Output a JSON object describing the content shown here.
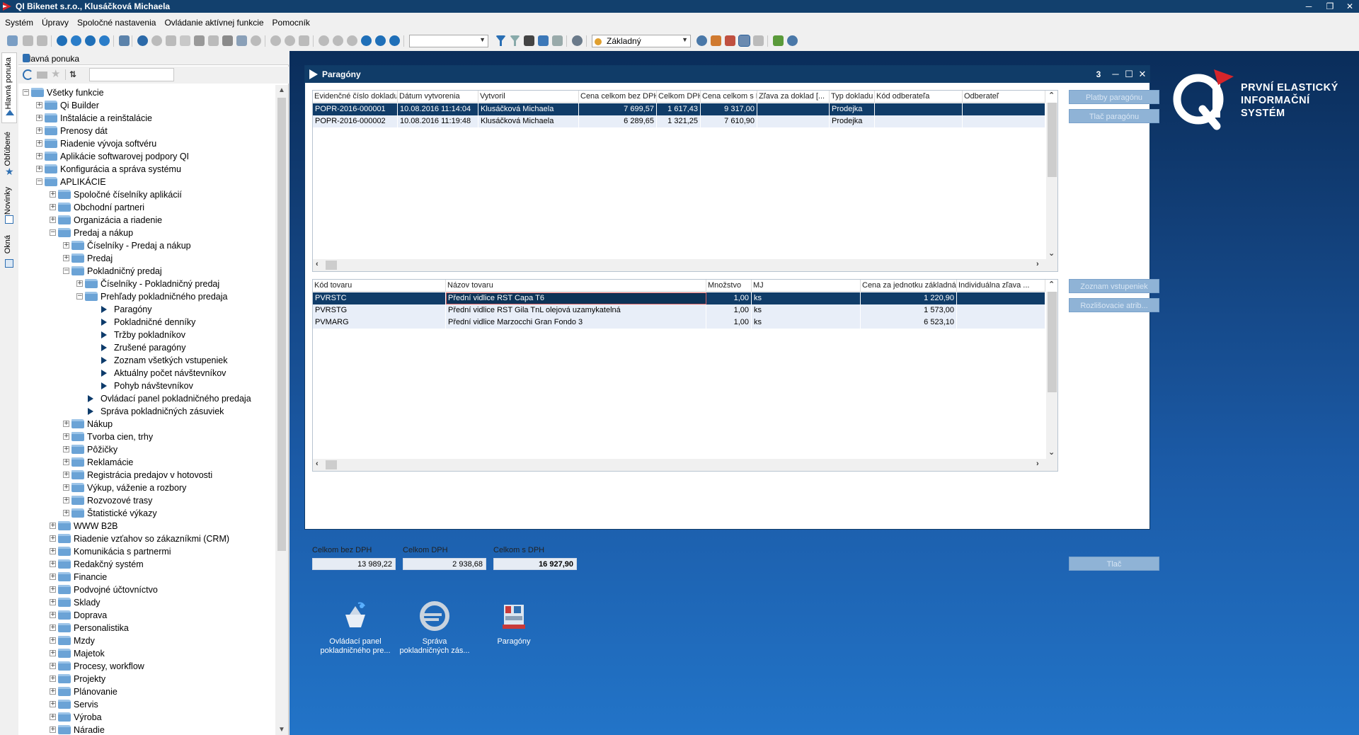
{
  "app": {
    "title": "QI  Bikenet s.r.o., Klusáčková Michaela",
    "controls": {
      "minimize": "─",
      "restore": "❐",
      "close": "✕"
    }
  },
  "menu": [
    "Systém",
    "Úpravy",
    "Spoločné nastavenia",
    "Ovládanie aktívnej funkcie",
    "Pomocník"
  ],
  "toolbar": {
    "view_combo": "Základný",
    "accent": "#2e6fb2"
  },
  "vtabs": [
    "Hlavná ponuka",
    "Obľúbené",
    "Novinky",
    "Okná"
  ],
  "left_panel": {
    "title": "Hlavná ponuka",
    "search_placeholder": ""
  },
  "tree": [
    {
      "label": "Všetky funkcie",
      "level": 0,
      "type": "folder",
      "exp": "-"
    },
    {
      "label": "Qi Builder",
      "level": 1,
      "type": "folder",
      "exp": "+"
    },
    {
      "label": "Inštalácie a reinštalácie",
      "level": 1,
      "type": "folder",
      "exp": "+"
    },
    {
      "label": "Prenosy dát",
      "level": 1,
      "type": "folder",
      "exp": "+"
    },
    {
      "label": "Riadenie vývoja softvéru",
      "level": 1,
      "type": "folder",
      "exp": "+"
    },
    {
      "label": "Aplikácie softwarovej podpory QI",
      "level": 1,
      "type": "folder",
      "exp": "+"
    },
    {
      "label": "Konfigurácia a správa systému",
      "level": 1,
      "type": "folder",
      "exp": "+"
    },
    {
      "label": "APLIKÁCIE",
      "level": 1,
      "type": "folder",
      "exp": "-"
    },
    {
      "label": "Spoločné číselníky aplikácií",
      "level": 2,
      "type": "folder",
      "exp": "+"
    },
    {
      "label": "Obchodní partneri",
      "level": 2,
      "type": "folder",
      "exp": "+"
    },
    {
      "label": "Organizácia a riadenie",
      "level": 2,
      "type": "folder",
      "exp": "+"
    },
    {
      "label": "Predaj a nákup",
      "level": 2,
      "type": "folder",
      "exp": "-"
    },
    {
      "label": "Číselníky - Predaj a nákup",
      "level": 3,
      "type": "folder",
      "exp": "+"
    },
    {
      "label": "Predaj",
      "level": 3,
      "type": "folder",
      "exp": "+"
    },
    {
      "label": "Pokladničný predaj",
      "level": 3,
      "type": "folder",
      "exp": "-"
    },
    {
      "label": "Číselníky - Pokladničný predaj",
      "level": 4,
      "type": "folder",
      "exp": "+"
    },
    {
      "label": "Prehľady pokladničného predaja",
      "level": 4,
      "type": "folder",
      "exp": "-"
    },
    {
      "label": "Paragóny",
      "level": 5,
      "type": "leaf"
    },
    {
      "label": "Pokladničné denníky",
      "level": 5,
      "type": "leaf"
    },
    {
      "label": "Tržby pokladníkov",
      "level": 5,
      "type": "leaf"
    },
    {
      "label": "Zrušené paragóny",
      "level": 5,
      "type": "leaf"
    },
    {
      "label": "Zoznam všetkých vstupeniek",
      "level": 5,
      "type": "leaf"
    },
    {
      "label": "Aktuálny počet návštevníkov",
      "level": 5,
      "type": "leaf"
    },
    {
      "label": "Pohyb návštevníkov",
      "level": 5,
      "type": "leaf"
    },
    {
      "label": "Ovládací panel pokladničného predaja",
      "level": 4,
      "type": "leaf"
    },
    {
      "label": "Správa pokladničných zásuviek",
      "level": 4,
      "type": "leaf"
    },
    {
      "label": "Nákup",
      "level": 3,
      "type": "folder",
      "exp": "+"
    },
    {
      "label": "Tvorba cien, trhy",
      "level": 3,
      "type": "folder",
      "exp": "+"
    },
    {
      "label": "Pôžičky",
      "level": 3,
      "type": "folder",
      "exp": "+"
    },
    {
      "label": "Reklamácie",
      "level": 3,
      "type": "folder",
      "exp": "+"
    },
    {
      "label": "Registrácia predajov v hotovosti",
      "level": 3,
      "type": "folder",
      "exp": "+"
    },
    {
      "label": "Výkup, váženie a rozbory",
      "level": 3,
      "type": "folder",
      "exp": "+"
    },
    {
      "label": "Rozvozové trasy",
      "level": 3,
      "type": "folder",
      "exp": "+"
    },
    {
      "label": "Štatistické výkazy",
      "level": 3,
      "type": "folder",
      "exp": "+"
    },
    {
      "label": "WWW B2B",
      "level": 2,
      "type": "folder",
      "exp": "+"
    },
    {
      "label": "Riadenie vzťahov so zákazníkmi (CRM)",
      "level": 2,
      "type": "folder",
      "exp": "+"
    },
    {
      "label": "Komunikácia s partnermi",
      "level": 2,
      "type": "folder",
      "exp": "+"
    },
    {
      "label": "Redakčný systém",
      "level": 2,
      "type": "folder",
      "exp": "+"
    },
    {
      "label": "Financie",
      "level": 2,
      "type": "folder",
      "exp": "+"
    },
    {
      "label": "Podvojné účtovníctvo",
      "level": 2,
      "type": "folder",
      "exp": "+"
    },
    {
      "label": "Sklady",
      "level": 2,
      "type": "folder",
      "exp": "+"
    },
    {
      "label": "Doprava",
      "level": 2,
      "type": "folder",
      "exp": "+"
    },
    {
      "label": "Personalistika",
      "level": 2,
      "type": "folder",
      "exp": "+"
    },
    {
      "label": "Mzdy",
      "level": 2,
      "type": "folder",
      "exp": "+"
    },
    {
      "label": "Majetok",
      "level": 2,
      "type": "folder",
      "exp": "+"
    },
    {
      "label": "Procesy, workflow",
      "level": 2,
      "type": "folder",
      "exp": "+"
    },
    {
      "label": "Projekty",
      "level": 2,
      "type": "folder",
      "exp": "+"
    },
    {
      "label": "Plánovanie",
      "level": 2,
      "type": "folder",
      "exp": "+"
    },
    {
      "label": "Servis",
      "level": 2,
      "type": "folder",
      "exp": "+"
    },
    {
      "label": "Výroba",
      "level": 2,
      "type": "folder",
      "exp": "+"
    },
    {
      "label": "Náradie",
      "level": 2,
      "type": "folder",
      "exp": "+"
    }
  ],
  "window": {
    "title": "Paragóny",
    "count": "3",
    "grid1": {
      "columns": [
        "Evidenčné číslo dokladu",
        "Dátum vytvorenia",
        "Vytvoril",
        "Cena celkom bez DPH",
        "Celkom DPH",
        "Cena celkom s DPH",
        "Zľava za doklad [...",
        "Typ dokladu",
        "Kód odberateľa",
        "Odberateľ"
      ],
      "rows": [
        [
          "POPR-2016-000001",
          "10.08.2016 11:14:04",
          "Klusáčková Michaela",
          "7 699,57",
          "1 617,43",
          "9 317,00",
          "",
          "Prodejka",
          "",
          ""
        ],
        [
          "POPR-2016-000002",
          "10.08.2016 11:19:48",
          "Klusáčková Michaela",
          "6 289,65",
          "1 321,25",
          "7 610,90",
          "",
          "Prodejka",
          "",
          ""
        ]
      ]
    },
    "grid2": {
      "columns": [
        "Kód tovaru",
        "Názov tovaru",
        "Množstvo",
        "MJ",
        "Cena za jednotku základná",
        "Individuálna zľava ..."
      ],
      "rows": [
        [
          "PVRSTC",
          "Přední vidlice RST Capa T6",
          "1,00",
          "ks",
          "1 220,90",
          ""
        ],
        [
          "PVRSTG",
          "Přední vidlice RST Gila TnL olejová uzamykatelná",
          "1,00",
          "ks",
          "1 573,00",
          ""
        ],
        [
          "PVMARG",
          "Přední vidlice Marzocchi Gran Fondo 3",
          "1,00",
          "ks",
          "6 523,10",
          ""
        ]
      ]
    },
    "buttons": {
      "platby": "Platby paragónu",
      "tlac_paragonu": "Tlač paragónu",
      "zoznam": "Zoznam vstupeniek",
      "rozlisovacie": "Rozlišovacie atrib...",
      "tlac": "Tlač"
    },
    "totals": {
      "bez_dph_label": "Celkom bez DPH",
      "bez_dph": "13 989,22",
      "dph_label": "Celkom DPH",
      "dph": "2 938,68",
      "s_dph_label": "Celkom s DPH",
      "s_dph": "16 927,90"
    }
  },
  "logo": {
    "line1": "PRVNÍ ELASTICKÝ",
    "line2": "INFORMAČNÍ",
    "line3": "SYSTÉM"
  },
  "desktop_icons": [
    {
      "caption": "Ovládací panel pokladničného pre..."
    },
    {
      "caption": "Správa pokladničných zás..."
    },
    {
      "caption": "Paragóny"
    }
  ]
}
